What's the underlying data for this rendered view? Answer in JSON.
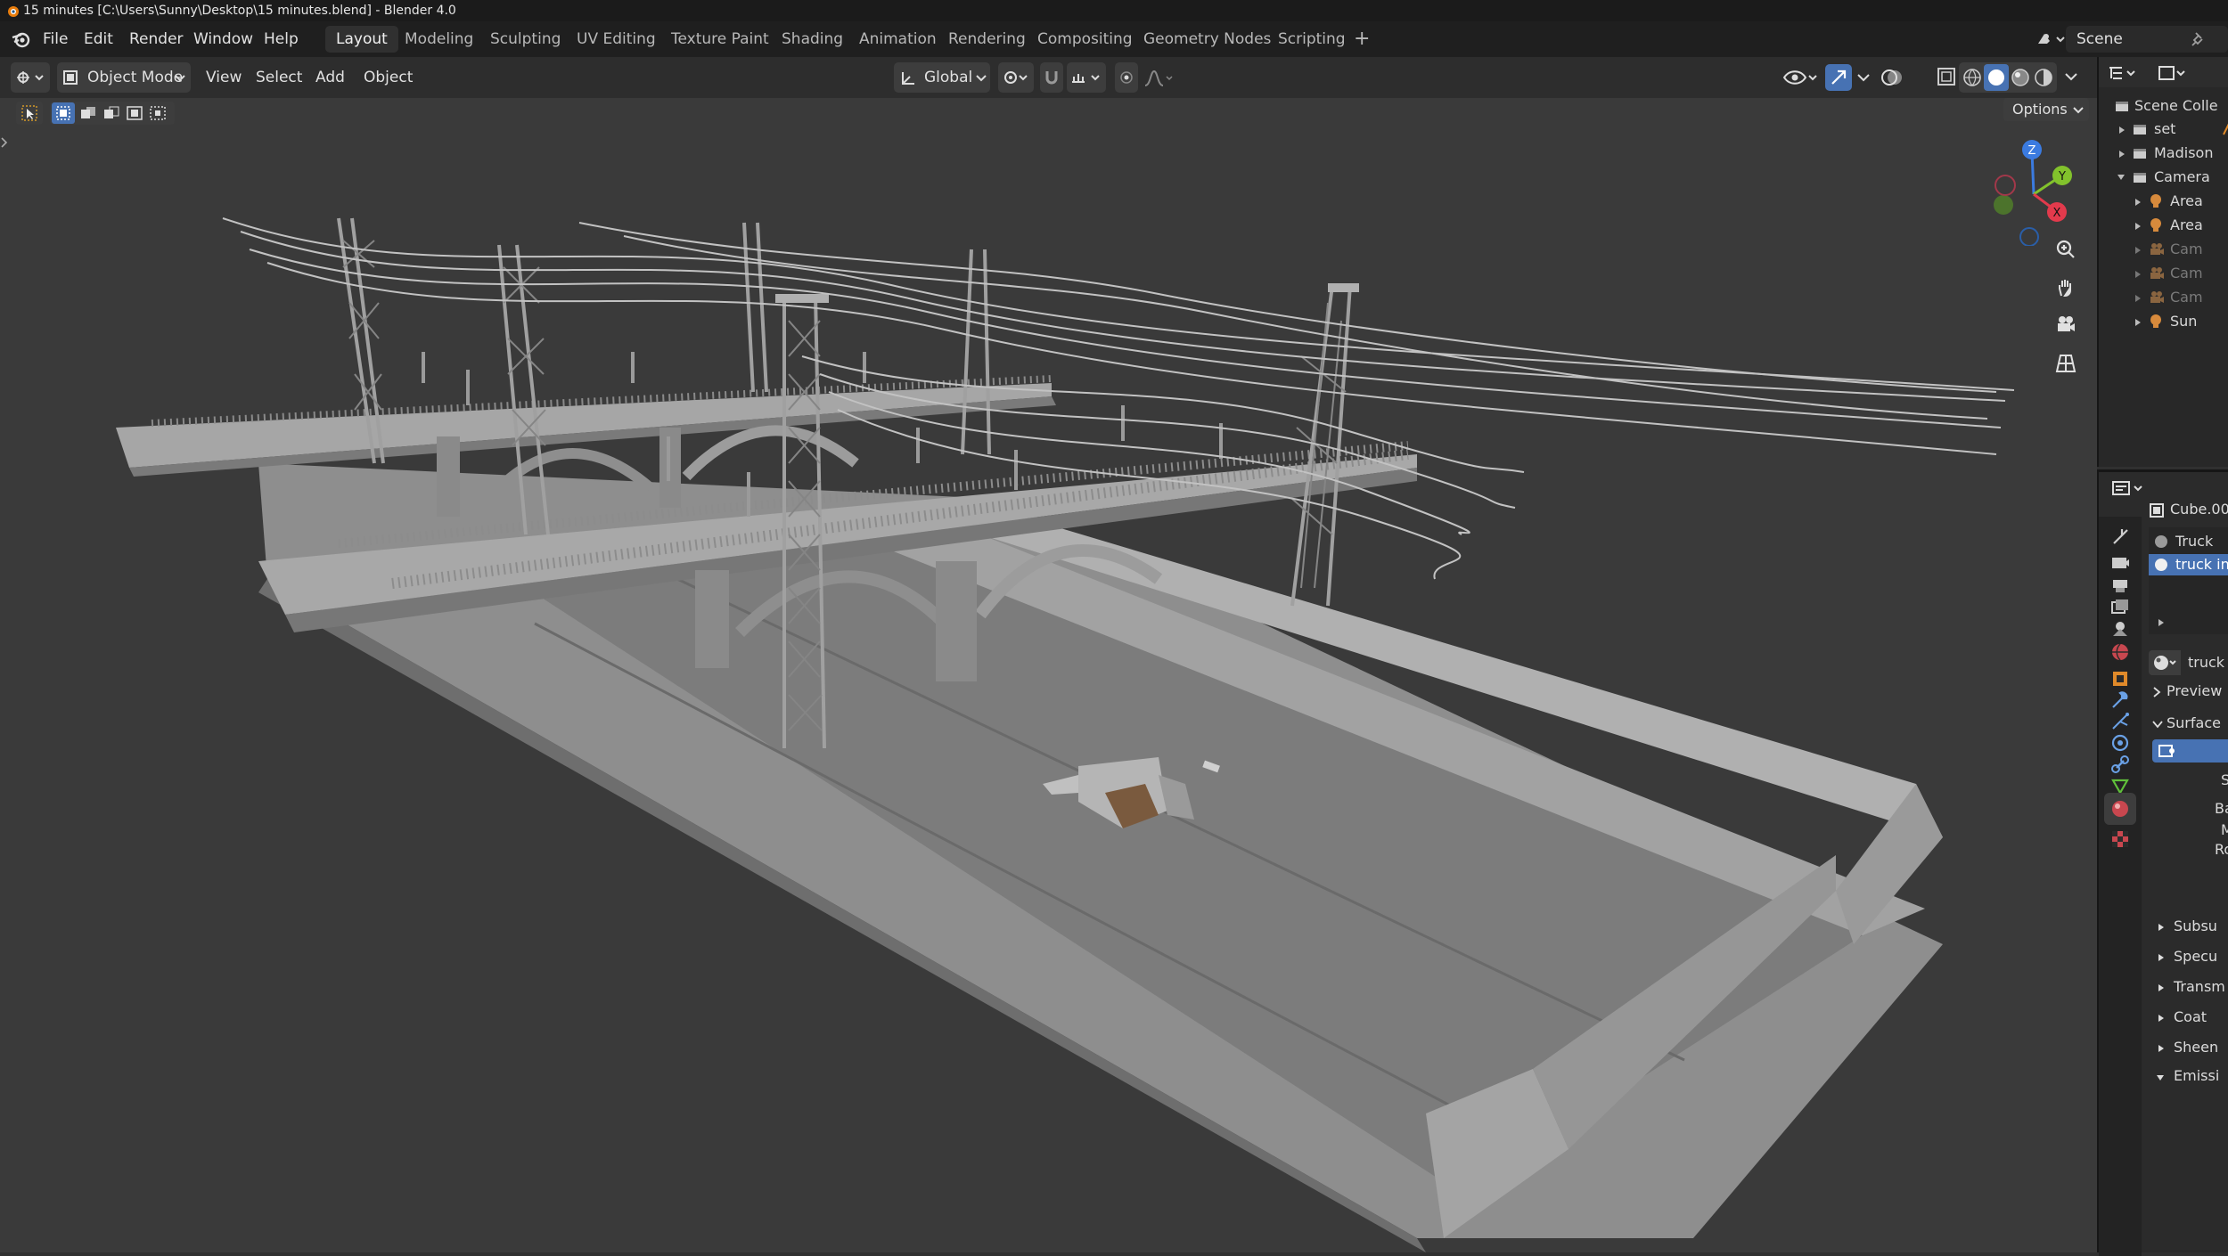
{
  "window": {
    "title": "15 minutes [C:\\Users\\Sunny\\Desktop\\15 minutes.blend] - Blender 4.0"
  },
  "menu": {
    "file": "File",
    "edit": "Edit",
    "render": "Render",
    "window": "Window",
    "help": "Help"
  },
  "workspaces": [
    "Layout",
    "Modeling",
    "Sculpting",
    "UV Editing",
    "Texture Paint",
    "Shading",
    "Animation",
    "Rendering",
    "Compositing",
    "Geometry Nodes",
    "Scripting"
  ],
  "scene": {
    "name": "Scene"
  },
  "viewport_header": {
    "mode": "Object Mode",
    "view": "View",
    "select": "Select",
    "add": "Add",
    "object": "Object",
    "orientation": "Global",
    "options": "Options"
  },
  "gizmo": {
    "z": "Z",
    "y": "Y",
    "x": "X"
  },
  "outliner": {
    "header": "Scene Colle",
    "items": [
      "set",
      "Madison",
      "Camera",
      "Area",
      "Area",
      "Cam",
      "Cam",
      "Cam",
      "Sun"
    ]
  },
  "properties": {
    "object_name": "Cube.00",
    "materials": [
      "Truck",
      "truck in"
    ],
    "material_field": "truck",
    "panels": {
      "preview": "Preview",
      "surface": "Surface"
    },
    "surface_rows": [
      "S",
      "Bas",
      "M",
      "Rou"
    ],
    "subpanels": [
      "Subsu",
      "Specu",
      "Transm",
      "Coat",
      "Sheen",
      "Emissi"
    ]
  },
  "colors": {
    "accent": "#4772b3",
    "axis_x": "#e23a4c",
    "axis_y": "#82c22c",
    "axis_z": "#3b7be0"
  }
}
